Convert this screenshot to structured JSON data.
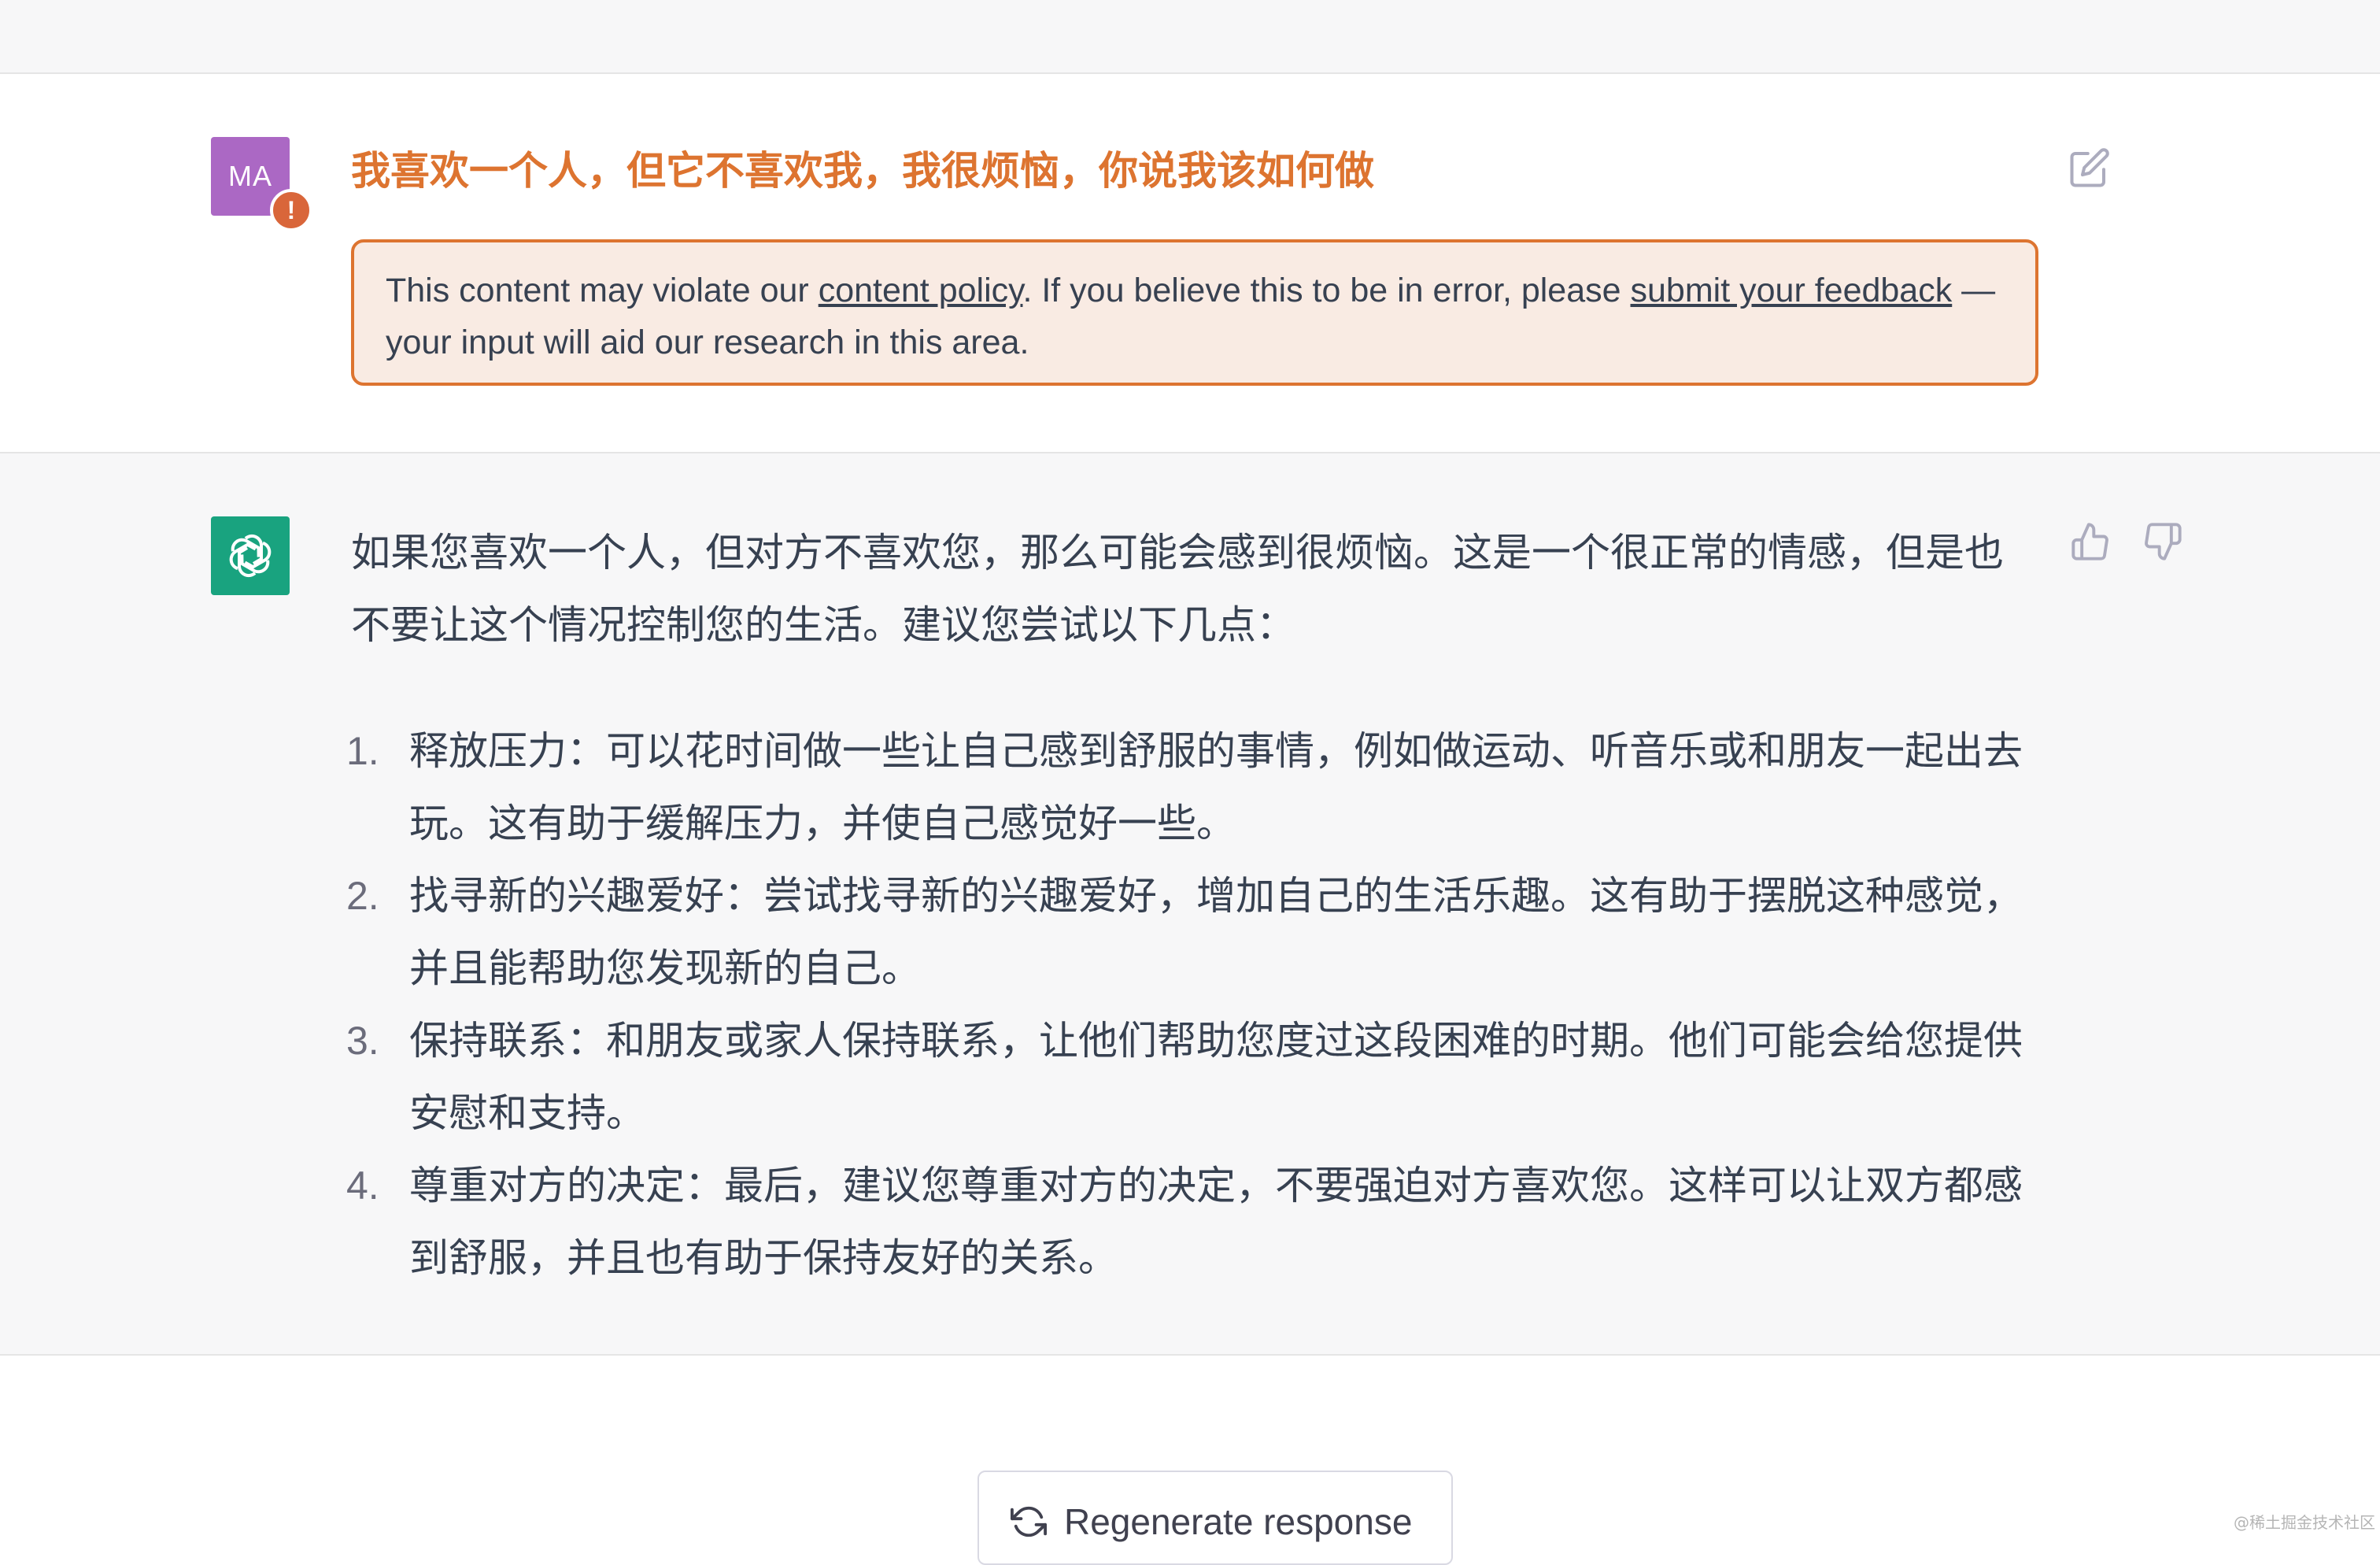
{
  "user_message": {
    "avatar_initials": "MA",
    "warning_badge": "!",
    "text": "我喜欢一个人，但它不喜欢我，我很烦恼，你说我该如何做"
  },
  "content_warning": {
    "text_before_policy": "This content may violate our ",
    "policy_link": "content policy",
    "text_middle": ". If you believe this to be in error, please ",
    "feedback_link": "submit your feedback",
    "text_after": " — your input will aid our research in this area."
  },
  "assistant_message": {
    "intro": "如果您喜欢一个人，但对方不喜欢您，那么可能会感到很烦恼。这是一个很正常的情感，但是也不要让这个情况控制您的生活。建议您尝试以下几点：",
    "items": [
      {
        "number": "1.",
        "text": "释放压力：可以花时间做一些让自己感到舒服的事情，例如做运动、听音乐或和朋友一起出去玩。这有助于缓解压力，并使自己感觉好一些。"
      },
      {
        "number": "2.",
        "text": "找寻新的兴趣爱好：尝试找寻新的兴趣爱好，增加自己的生活乐趣。这有助于摆脱这种感觉，并且能帮助您发现新的自己。"
      },
      {
        "number": "3.",
        "text": "保持联系：和朋友或家人保持联系，让他们帮助您度过这段困难的时期。他们可能会给您提供安慰和支持。"
      },
      {
        "number": "4.",
        "text": "尊重对方的决定：最后，建议您尊重对方的决定，不要强迫对方喜欢您。这样可以让双方都感到舒服，并且也有助于保持友好的关系。"
      }
    ]
  },
  "actions": {
    "regenerate_label": "Regenerate response"
  },
  "icons": {
    "edit": "edit-icon",
    "thumbs_up": "thumbs-up-icon",
    "thumbs_down": "thumbs-down-icon",
    "regenerate": "refresh-icon",
    "assistant_logo": "openai-logo-icon"
  },
  "colors": {
    "user_avatar": "#ab68c4",
    "warning_orange": "#dd7430",
    "warning_bg": "#f9ebe3",
    "assistant_avatar": "#19a37f",
    "assistant_bg": "#f7f7f8"
  },
  "watermark": "@稀土掘金技术社区"
}
